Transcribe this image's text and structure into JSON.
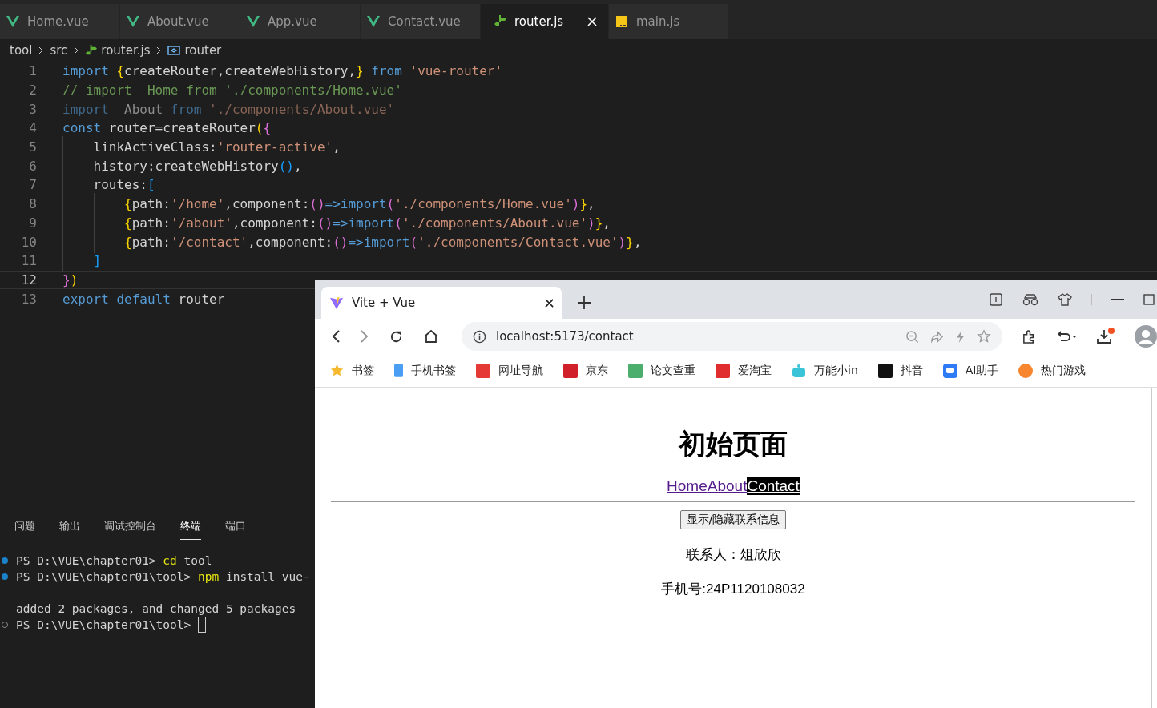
{
  "editor_tabs": [
    {
      "label": "Home.vue",
      "kind": "vue",
      "selected": false
    },
    {
      "label": "About.vue",
      "kind": "vue",
      "selected": false
    },
    {
      "label": "App.vue",
      "kind": "vue",
      "selected": false
    },
    {
      "label": "Contact.vue",
      "kind": "vue",
      "selected": false
    },
    {
      "label": "router.js",
      "kind": "router",
      "selected": true,
      "closable": true
    },
    {
      "label": "main.js",
      "kind": "js",
      "selected": false
    }
  ],
  "breadcrumb": [
    {
      "label": "tool",
      "kind": "folder"
    },
    {
      "label": "src",
      "kind": "folder"
    },
    {
      "label": "router.js",
      "kind": "router"
    },
    {
      "label": "router",
      "kind": "symbol"
    }
  ],
  "code_lines": [
    {
      "number": "1",
      "current": false,
      "unused": false,
      "tokens": [
        {
          "kind": "kw",
          "text": "import"
        },
        {
          "kind": "b1",
          "text": " {"
        },
        {
          "kind": "plain",
          "text": "createRouter,createWebHistory,"
        },
        {
          "kind": "b1",
          "text": "}"
        },
        {
          "kind": "kw",
          "text": " from"
        },
        {
          "kind": "str",
          "text": " 'vue-router'"
        }
      ]
    },
    {
      "number": "2",
      "current": false,
      "unused": false,
      "tokens": [
        {
          "kind": "comment",
          "text": "// import  Home from './components/Home.vue'"
        }
      ]
    },
    {
      "number": "3",
      "current": false,
      "unused": true,
      "tokens": [
        {
          "kind": "kw",
          "text": "import"
        },
        {
          "kind": "plain",
          "text": "  About"
        },
        {
          "kind": "kw",
          "text": " from"
        },
        {
          "kind": "str",
          "text": " './components/About.vue'"
        }
      ]
    },
    {
      "number": "4",
      "current": false,
      "unused": false,
      "tokens": [
        {
          "kind": "kw",
          "text": "const"
        },
        {
          "kind": "plain",
          "text": " router=createRouter"
        },
        {
          "kind": "b1",
          "text": "("
        },
        {
          "kind": "b2",
          "text": "{"
        }
      ]
    },
    {
      "number": "5",
      "current": false,
      "unused": false,
      "tokens": [
        {
          "kind": "plain",
          "text": "    linkActiveClass:"
        },
        {
          "kind": "str",
          "text": "'router-active'"
        },
        {
          "kind": "plain",
          "text": ","
        }
      ]
    },
    {
      "number": "6",
      "current": false,
      "unused": false,
      "tokens": [
        {
          "kind": "plain",
          "text": "    history:createWebHistory"
        },
        {
          "kind": "b3",
          "text": "()"
        },
        {
          "kind": "plain",
          "text": ","
        }
      ]
    },
    {
      "number": "7",
      "current": false,
      "unused": false,
      "tokens": [
        {
          "kind": "plain",
          "text": "    routes:"
        },
        {
          "kind": "b3",
          "text": "["
        }
      ]
    },
    {
      "number": "8",
      "current": false,
      "unused": false,
      "tokens": [
        {
          "kind": "b1",
          "text": "        {"
        },
        {
          "kind": "plain",
          "text": "path:"
        },
        {
          "kind": "str",
          "text": "'/home'"
        },
        {
          "kind": "plain",
          "text": ",component:"
        },
        {
          "kind": "b2",
          "text": "()"
        },
        {
          "kind": "kw",
          "text": "=>import"
        },
        {
          "kind": "b2",
          "text": "("
        },
        {
          "kind": "str",
          "text": "'./components/Home.vue'"
        },
        {
          "kind": "b2",
          "text": ")"
        },
        {
          "kind": "b1",
          "text": "}"
        },
        {
          "kind": "plain",
          "text": ","
        }
      ]
    },
    {
      "number": "9",
      "current": false,
      "unused": false,
      "tokens": [
        {
          "kind": "b1",
          "text": "        {"
        },
        {
          "kind": "plain",
          "text": "path:"
        },
        {
          "kind": "str",
          "text": "'/about'"
        },
        {
          "kind": "plain",
          "text": ",component:"
        },
        {
          "kind": "b2",
          "text": "()"
        },
        {
          "kind": "kw",
          "text": "=>import"
        },
        {
          "kind": "b2",
          "text": "("
        },
        {
          "kind": "str",
          "text": "'./components/About.vue'"
        },
        {
          "kind": "b2",
          "text": ")"
        },
        {
          "kind": "b1",
          "text": "}"
        },
        {
          "kind": "plain",
          "text": ","
        }
      ]
    },
    {
      "number": "10",
      "current": false,
      "unused": false,
      "tokens": [
        {
          "kind": "b1",
          "text": "        {"
        },
        {
          "kind": "plain",
          "text": "path:"
        },
        {
          "kind": "str",
          "text": "'/contact'"
        },
        {
          "kind": "plain",
          "text": ",component:"
        },
        {
          "kind": "b2",
          "text": "()"
        },
        {
          "kind": "kw",
          "text": "=>import"
        },
        {
          "kind": "b2",
          "text": "("
        },
        {
          "kind": "str",
          "text": "'./components/Contact.vue'"
        },
        {
          "kind": "b2",
          "text": ")"
        },
        {
          "kind": "b1",
          "text": "}"
        },
        {
          "kind": "plain",
          "text": ","
        }
      ]
    },
    {
      "number": "11",
      "current": false,
      "unused": false,
      "tokens": [
        {
          "kind": "b3",
          "text": "    ]"
        }
      ]
    },
    {
      "number": "12",
      "current": true,
      "unused": false,
      "tokens": [
        {
          "kind": "b2",
          "text": "}"
        },
        {
          "kind": "b1",
          "text": ")"
        }
      ]
    },
    {
      "number": "13",
      "current": false,
      "unused": false,
      "tokens": [
        {
          "kind": "kw",
          "text": "export"
        },
        {
          "kind": "kw",
          "text": " default"
        },
        {
          "kind": "plain",
          "text": " router"
        }
      ]
    }
  ],
  "panel_tabs": [
    {
      "label": "问题",
      "selected": false
    },
    {
      "label": "输出",
      "selected": false
    },
    {
      "label": "调试控制台",
      "selected": false
    },
    {
      "label": "终端",
      "selected": true
    },
    {
      "label": "端口",
      "selected": false
    }
  ],
  "terminal_lines": [
    {
      "kind": "done",
      "tokens": [
        {
          "kind": "plain",
          "text": "PS D:\\VUE\\chapter01> "
        },
        {
          "kind": "cmd",
          "text": "cd"
        },
        {
          "kind": "plain",
          "text": " tool"
        }
      ]
    },
    {
      "kind": "done",
      "tokens": [
        {
          "kind": "plain",
          "text": "PS D:\\VUE\\chapter01\\tool> "
        },
        {
          "kind": "cmd",
          "text": "npm"
        },
        {
          "kind": "plain",
          "text": " install vue-"
        }
      ]
    },
    {
      "kind": "blank"
    },
    {
      "kind": "output",
      "tokens": [
        {
          "kind": "plain",
          "text": "added 2 packages, and changed 5 packages"
        }
      ]
    },
    {
      "kind": "pending",
      "cursor": true,
      "tokens": [
        {
          "kind": "plain",
          "text": "PS D:\\VUE\\chapter01\\tool>"
        }
      ]
    }
  ],
  "browser": {
    "tab_title": "Vite + Vue",
    "url": "localhost:5173/contact",
    "bookmarks": [
      {
        "label": "书签",
        "kind": "star",
        "color": "#f5b82e"
      },
      {
        "label": "手机书签",
        "kind": "phone",
        "color": "#4a9ff5"
      },
      {
        "label": "网址导航",
        "kind": "square",
        "color": "#e53935"
      },
      {
        "label": "京东",
        "kind": "square",
        "color": "#d0202a"
      },
      {
        "label": "论文查重",
        "kind": "square",
        "color": "#4cae6c"
      },
      {
        "label": "爱淘宝",
        "kind": "square",
        "color": "#e02e2e"
      },
      {
        "label": "万能小in",
        "kind": "robot",
        "color": "#3bc4d8"
      },
      {
        "label": "抖音",
        "kind": "square",
        "color": "#111111"
      },
      {
        "label": "AI助手",
        "kind": "chat",
        "color": "#2f7bf5"
      },
      {
        "label": "热门游戏",
        "kind": "circle",
        "color": "#f7862e"
      }
    ],
    "page": {
      "heading": "初始页面",
      "nav": [
        {
          "label": "Home",
          "selected": false
        },
        {
          "label": "About",
          "selected": false
        },
        {
          "label": "Contact",
          "selected": true
        }
      ],
      "toggle_button": "显示/隐藏联系信息",
      "contact": "联系人：俎欣欣",
      "phone": "手机号:24P1120108032"
    }
  }
}
